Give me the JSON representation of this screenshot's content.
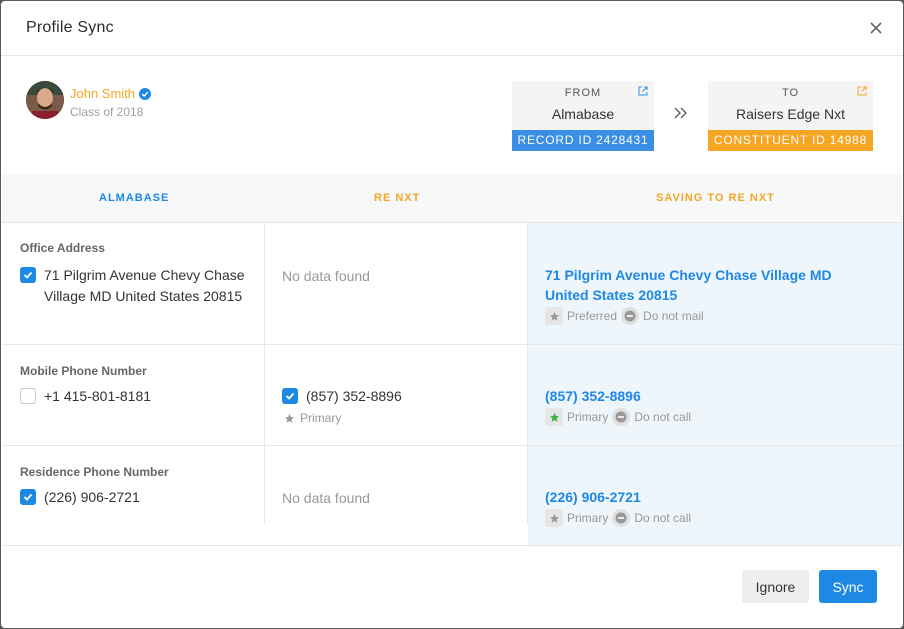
{
  "modal": {
    "title": "Profile Sync"
  },
  "profile": {
    "name": "John Smith",
    "class_of": "Class of 2018"
  },
  "from": {
    "label": "FROM",
    "name": "Almabase",
    "id": "RECORD ID 2428431",
    "id_color": "#3a8ee6"
  },
  "to": {
    "label": "TO",
    "name": "Raisers Edge Nxt",
    "id": "CONSTITUENT ID 14988",
    "id_color": "#f5a623"
  },
  "columns": {
    "almabase": "ALMABASE",
    "renxt": "RE NXT",
    "saving": "SAVING TO RE NXT"
  },
  "rows": [
    {
      "label": "Office Address",
      "almabase": {
        "value": "71 Pilgrim Avenue Chevy Chase Village MD United States 20815",
        "checked": true
      },
      "renxt": {
        "nodata": "No data found"
      },
      "saving": {
        "value": "71 Pilgrim Avenue Chevy Chase Village MD United States 20815",
        "tag1": "Preferred",
        "tag2": "Do not mail"
      }
    },
    {
      "label": "Mobile Phone Number",
      "almabase": {
        "value": "+1 415-801-8181",
        "checked": false
      },
      "renxt": {
        "value": "(857) 352-8896",
        "checked": true,
        "tag": "Primary"
      },
      "saving": {
        "value": "(857) 352-8896",
        "tag1": "Primary",
        "tag2": "Do not call"
      }
    },
    {
      "label": "Residence Phone Number",
      "almabase": {
        "value": "(226) 906-2721",
        "checked": true
      },
      "renxt": {
        "nodata": "No data found"
      },
      "saving": {
        "value": "(226) 906-2721",
        "tag1": "Primary",
        "tag2": "Do not call"
      }
    }
  ],
  "buttons": {
    "ignore": "Ignore",
    "sync": "Sync"
  },
  "colors": {
    "accent": "#1e88e5",
    "orange": "#f5a623",
    "green": "#3cae48"
  }
}
